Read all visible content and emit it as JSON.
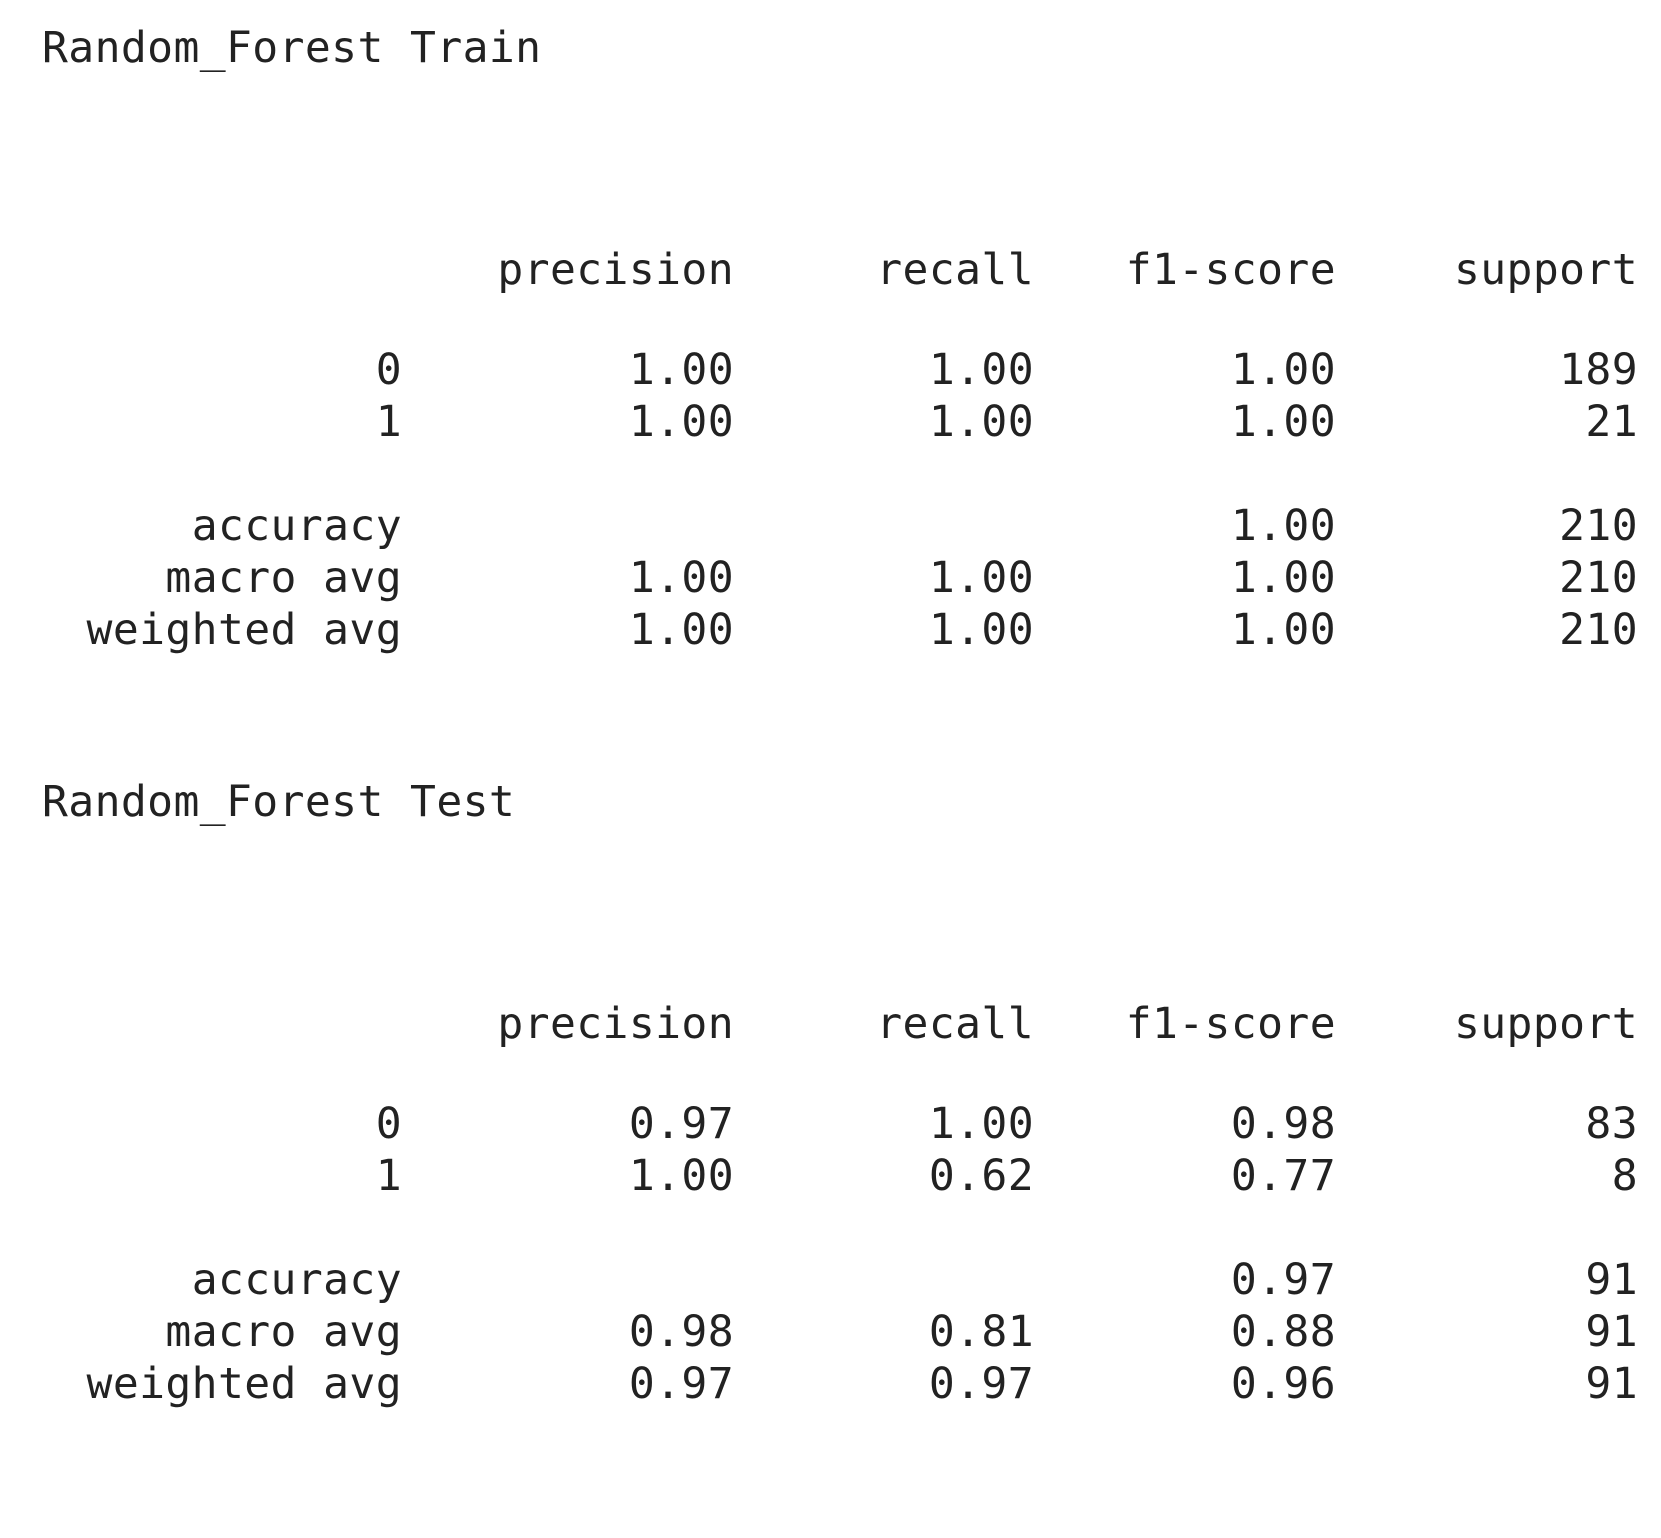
{
  "reports": [
    {
      "title": "Random_Forest Train",
      "headers": [
        "precision",
        "recall",
        "f1-score",
        "support"
      ],
      "class_rows": [
        {
          "label": "0",
          "precision": "1.00",
          "recall": "1.00",
          "f1": "1.00",
          "support": "189"
        },
        {
          "label": "1",
          "precision": "1.00",
          "recall": "1.00",
          "f1": "1.00",
          "support": "21"
        }
      ],
      "summary_rows": [
        {
          "label": "accuracy",
          "precision": "",
          "recall": "",
          "f1": "1.00",
          "support": "210"
        },
        {
          "label": "macro avg",
          "precision": "1.00",
          "recall": "1.00",
          "f1": "1.00",
          "support": "210"
        },
        {
          "label": "weighted avg",
          "precision": "1.00",
          "recall": "1.00",
          "f1": "1.00",
          "support": "210"
        }
      ]
    },
    {
      "title": "Random_Forest Test",
      "headers": [
        "precision",
        "recall",
        "f1-score",
        "support"
      ],
      "class_rows": [
        {
          "label": "0",
          "precision": "0.97",
          "recall": "1.00",
          "f1": "0.98",
          "support": "83"
        },
        {
          "label": "1",
          "precision": "1.00",
          "recall": "0.62",
          "f1": "0.77",
          "support": "8"
        }
      ],
      "summary_rows": [
        {
          "label": "accuracy",
          "precision": "",
          "recall": "",
          "f1": "0.97",
          "support": "91"
        },
        {
          "label": "macro avg",
          "precision": "0.98",
          "recall": "0.81",
          "f1": "0.88",
          "support": "91"
        },
        {
          "label": "weighted avg",
          "precision": "0.97",
          "recall": "0.97",
          "f1": "0.96",
          "support": "91"
        }
      ]
    }
  ]
}
